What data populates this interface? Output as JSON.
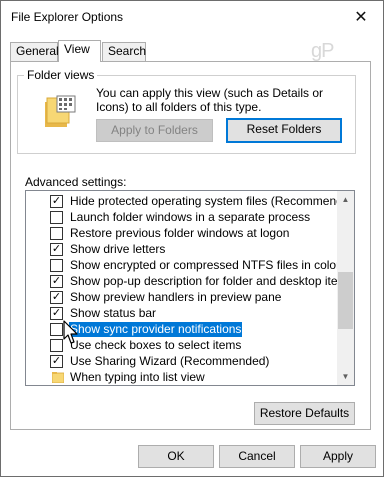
{
  "window": {
    "title": "File Explorer Options"
  },
  "tabs": [
    {
      "label": "General"
    },
    {
      "label": "View"
    },
    {
      "label": "Search"
    }
  ],
  "watermark": "gP",
  "folder_views": {
    "group_label": "Folder views",
    "description": "You can apply this view (such as Details or Icons) to all folders of this type.",
    "apply_button": "Apply to Folders",
    "reset_button": "Reset Folders"
  },
  "advanced": {
    "label": "Advanced settings:",
    "items": [
      {
        "label": "Hide protected operating system files (Recommended)",
        "checked": true
      },
      {
        "label": "Launch folder windows in a separate process",
        "checked": false
      },
      {
        "label": "Restore previous folder windows at logon",
        "checked": false
      },
      {
        "label": "Show drive letters",
        "checked": true
      },
      {
        "label": "Show encrypted or compressed NTFS files in color",
        "checked": false
      },
      {
        "label": "Show pop-up description for folder and desktop items",
        "checked": true
      },
      {
        "label": "Show preview handlers in preview pane",
        "checked": true
      },
      {
        "label": "Show status bar",
        "checked": true
      },
      {
        "label": "Show sync provider notifications",
        "checked": false,
        "selected": true
      },
      {
        "label": "Use check boxes to select items",
        "checked": false
      },
      {
        "label": "Use Sharing Wizard (Recommended)",
        "checked": true
      },
      {
        "label": "When typing into list view",
        "folder": true
      }
    ]
  },
  "restore_defaults": "Restore Defaults",
  "buttons": {
    "ok": "OK",
    "cancel": "Cancel",
    "apply": "Apply"
  },
  "colors": {
    "selection": "#0078d7",
    "focus_border": "#0078d7",
    "folder": "#f7d774"
  }
}
